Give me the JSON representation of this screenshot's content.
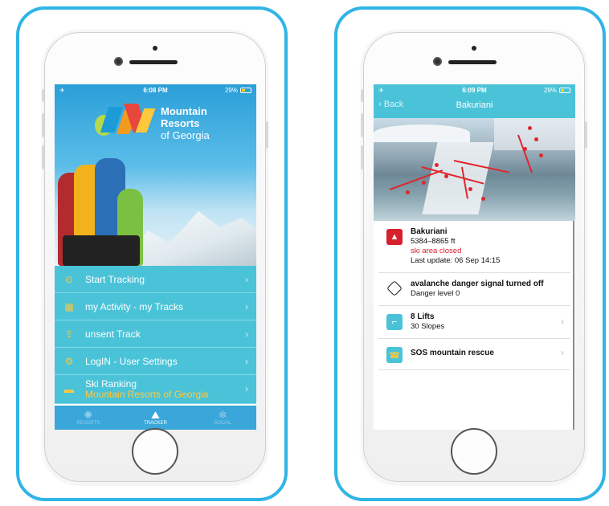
{
  "colors": {
    "frame": "#2fb5e6",
    "menu": "#4ac3d8",
    "accent": "#ffc83d",
    "alert": "#d6202b"
  },
  "left_screen": {
    "status": {
      "time": "6:08 PM",
      "battery": "29%"
    },
    "logo": {
      "line1": "Mountain",
      "line2": "Resorts",
      "line3": "of Georgia"
    },
    "menu": [
      {
        "icon": "play-circle-icon",
        "label": "Start Tracking"
      },
      {
        "icon": "calendar-icon",
        "label": "my Activity - my Tracks"
      },
      {
        "icon": "upload-icon",
        "label": "unsent Track"
      },
      {
        "icon": "gear-icon",
        "label": "LogIN - User Settings"
      },
      {
        "icon": "ranking-icon",
        "label": "Ski Ranking",
        "sublabel": "Mountain Resorts of Georgia"
      }
    ],
    "tabs": [
      {
        "icon": "snowflake-icon",
        "label": "RESORTS",
        "active": false
      },
      {
        "icon": "mountain-tracker-icon",
        "label": "TRACKER",
        "active": true
      },
      {
        "icon": "snowflake-icon",
        "label": "SOCIAL",
        "active": false
      }
    ]
  },
  "right_screen": {
    "status": {
      "time": "6:09 PM",
      "battery": "29%"
    },
    "nav": {
      "back": "Back",
      "title": "Bakuriani"
    },
    "resort": {
      "name": "Bakuriani",
      "altitude": "5384–8865 ft",
      "status": "ski area closed",
      "updated": "Last update: 06 Sep 14:15"
    },
    "avalanche": {
      "title": "avalanche danger signal turned off",
      "level": "Danger level 0"
    },
    "lifts": {
      "lifts": "8 Lifts",
      "slopes": "30 Slopes"
    },
    "sos": {
      "label": "SOS mountain rescue"
    }
  }
}
